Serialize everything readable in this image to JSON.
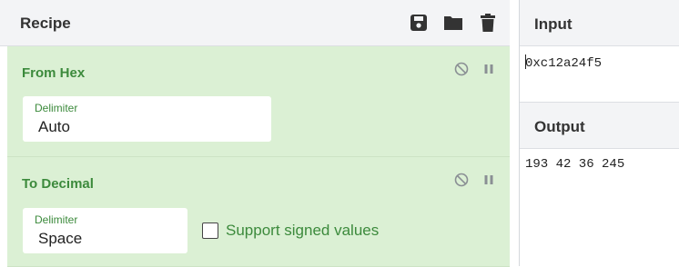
{
  "recipe": {
    "title": "Recipe",
    "controls": [
      {
        "name": "save-icon"
      },
      {
        "name": "folder-icon"
      },
      {
        "name": "trash-icon"
      }
    ],
    "operations": [
      {
        "title": "From Hex",
        "delimiter_label": "Delimiter",
        "delimiter_value": "Auto"
      },
      {
        "title": "To Decimal",
        "delimiter_label": "Delimiter",
        "delimiter_value": "Space",
        "checkbox_label": "Support signed values",
        "checkbox_checked": false
      }
    ]
  },
  "input": {
    "title": "Input",
    "text": "0xc12a24f5"
  },
  "output": {
    "title": "Output",
    "text": "193 42 36 245"
  },
  "colors": {
    "operation_bg": "#dbf0d4",
    "operation_text": "#3c8a3c",
    "header_bg": "#f3f4f6"
  }
}
